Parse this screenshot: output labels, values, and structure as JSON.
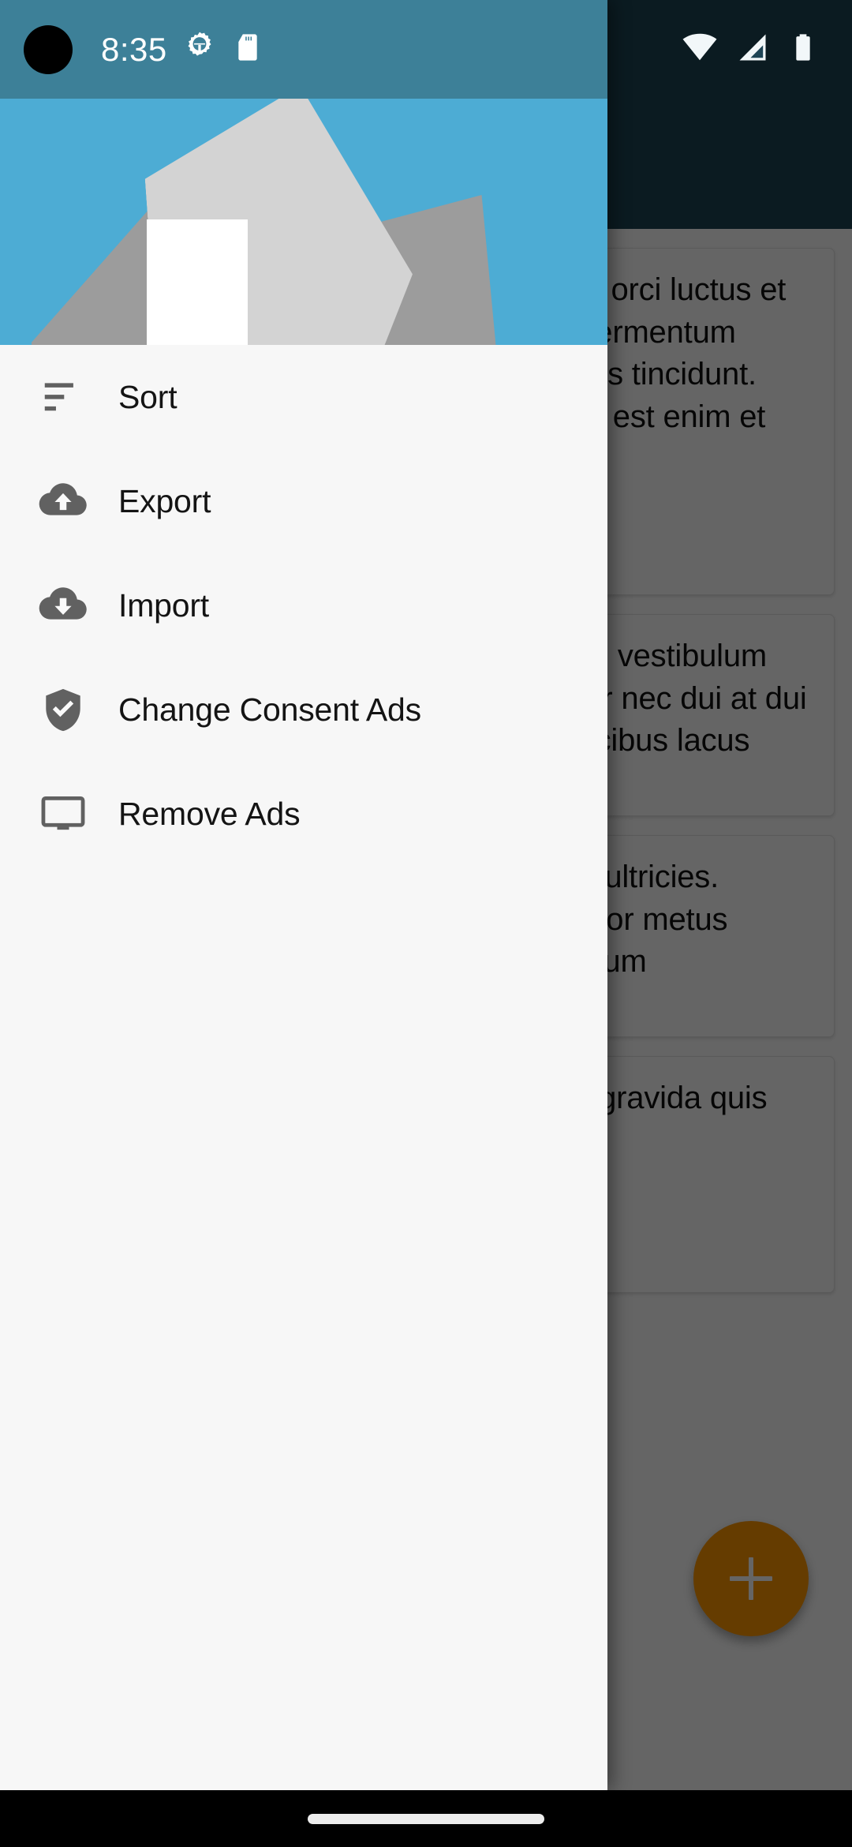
{
  "status_bar": {
    "clock": "8:35",
    "left_icons": [
      "android-gear-icon",
      "sd-card-icon"
    ],
    "right_icons": [
      "wifi-icon",
      "cell-signal-icon",
      "battery-icon"
    ],
    "drawer_bg_color": "#3D8098",
    "app_bg_color": "#1E4455"
  },
  "drawer": {
    "header": {
      "background_color": "#4DACD4",
      "artwork_name": "stacked-papers-illustration"
    },
    "items": [
      {
        "id": "sort",
        "label": "Sort",
        "icon": "sort-icon"
      },
      {
        "id": "export",
        "label": "Export",
        "icon": "cloud-upload-icon"
      },
      {
        "id": "import",
        "label": "Import",
        "icon": "cloud-download-icon"
      },
      {
        "id": "consent",
        "label": "Change Consent Ads",
        "icon": "shield-check-icon"
      },
      {
        "id": "remove-ads",
        "label": "Remove Ads",
        "icon": "monitor-icon"
      }
    ]
  },
  "app": {
    "notes": [
      {
        "text": "Vestibulum ante ipsum primis in faucibus orci luctus et ultrices posuere cubilia curae; Fusce id fermentum nunc. Sed ullamcorper ante vitae convallis tincidunt. Donec porta, augue sed tincidunt rutrum, est enim et lorem mattis tellus vel condimentum."
      },
      {
        "text": "Sed gravida libero quis lectus iaculis, sed vestibulum ante tortor quis, aliquam metus. Curabitur nec dui at dui mattis fames ac ante ipsum primis in faucibus lacus vitae nisl"
      },
      {
        "text": "Fusce aliquet quam eget neque rhoncus ultricies. Aenean condimentum justo a nunc porttitor metus tempus. Aliquam a massa magna bibendum"
      },
      {
        "text": "Praesent tristique magna sit amet purus gravida quis blandit turpis cursus in hac habitasse."
      }
    ],
    "fab": {
      "label": "+",
      "icon": "plus-icon",
      "color": "#FF9800"
    }
  },
  "nav_bar": {
    "gesture_pill": "home-gesture-pill"
  }
}
